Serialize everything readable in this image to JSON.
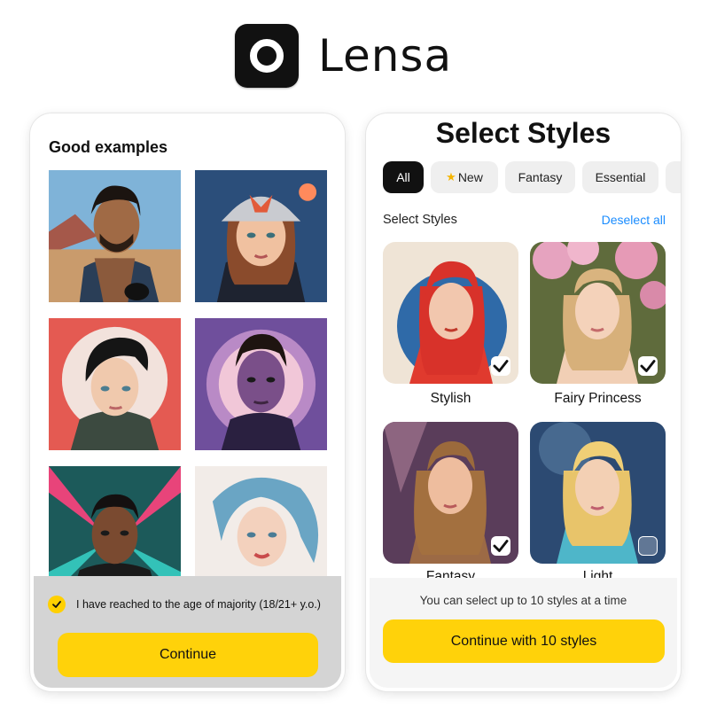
{
  "brand": {
    "name": "Lensa",
    "icon": "lens-ring-icon"
  },
  "onboarding": {
    "title": "Good examples",
    "examples": [
      {
        "icon": "portrait-man-desert"
      },
      {
        "icon": "portrait-woman-cap"
      },
      {
        "icon": "portrait-woman-short-hair"
      },
      {
        "icon": "portrait-man-purple"
      },
      {
        "icon": "portrait-man-neon"
      },
      {
        "icon": "portrait-woman-watercolor"
      }
    ],
    "age_check": {
      "checked": true,
      "label": "I have reached to the age of majority (18/21+ y.o.)"
    },
    "continue_label": "Continue"
  },
  "styles_screen": {
    "title": "Select Styles",
    "tabs": [
      {
        "label": "All",
        "active": true
      },
      {
        "label": "New",
        "icon": "star-icon",
        "active": false
      },
      {
        "label": "Fantasy",
        "active": false
      },
      {
        "label": "Essential",
        "active": false
      }
    ],
    "section_label": "Select Styles",
    "deselect_label": "Deselect all",
    "cards": [
      {
        "label": "Stylish",
        "selected": true
      },
      {
        "label": "Fairy Princess",
        "selected": true
      },
      {
        "label": "Fantasy",
        "selected": true
      },
      {
        "label": "Light",
        "selected": false
      }
    ],
    "limit_text": "You can select up to 10 styles at a time",
    "continue_label": "Continue with 10 styles"
  },
  "colors": {
    "accent_yellow": "#ffd20a",
    "link_blue": "#1a8cff",
    "active_tab": "#111111"
  }
}
